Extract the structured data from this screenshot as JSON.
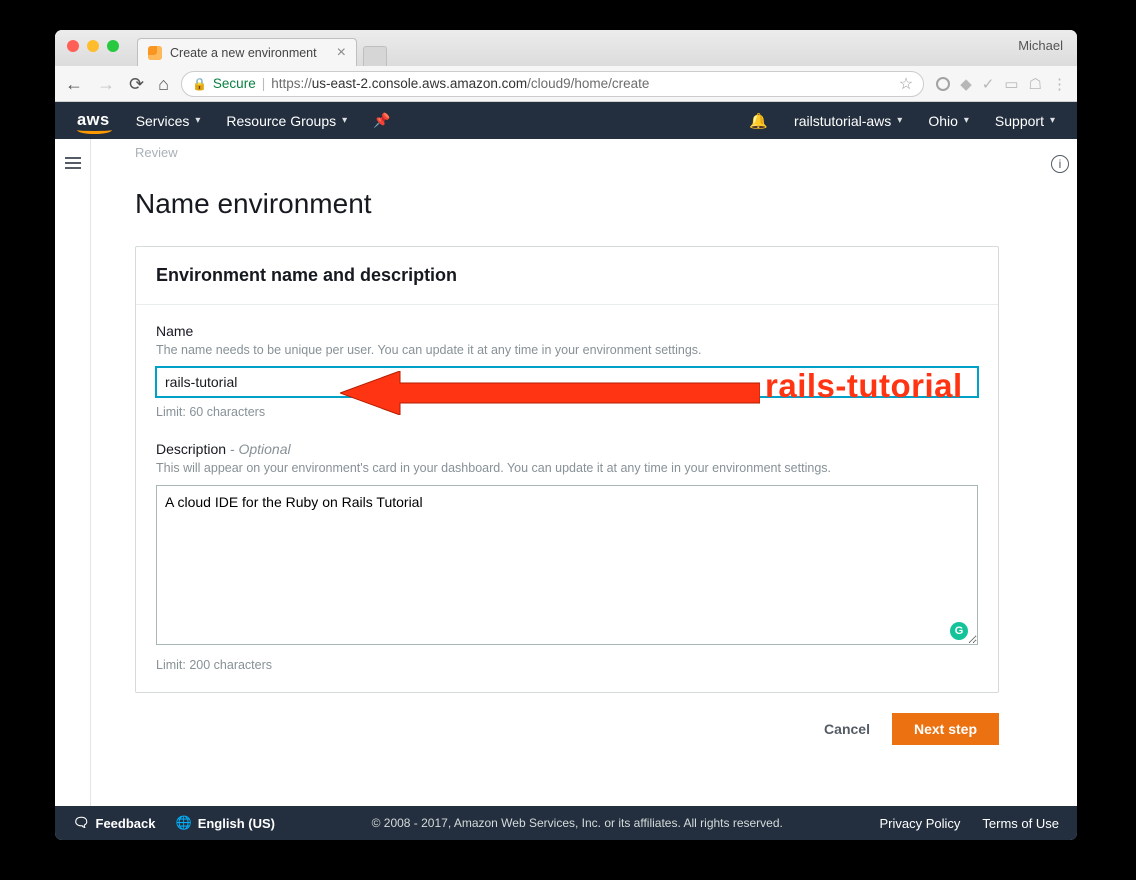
{
  "browser": {
    "profile": "Michael",
    "tab_title": "Create a new environment",
    "secure_label": "Secure",
    "url_prefix": "https://",
    "url_host": "us-east-2.console.aws.amazon.com",
    "url_path": "/cloud9/home/create"
  },
  "aws_nav": {
    "logo": "aws",
    "services": "Services",
    "resource_groups": "Resource Groups",
    "account": "railstutorial-aws",
    "region": "Ohio",
    "support": "Support"
  },
  "breadcrumb": "Review",
  "page_title": "Name environment",
  "panel": {
    "heading": "Environment name and description",
    "name_label": "Name",
    "name_help": "The name needs to be unique per user. You can update it at any time in your environment settings.",
    "name_value": "rails-tutorial",
    "name_limit": "Limit: 60 characters",
    "desc_label": "Description",
    "desc_optional": " - Optional",
    "desc_help": "This will appear on your environment's card in your dashboard. You can update it at any time in your environment settings.",
    "desc_value": "A cloud IDE for the Ruby on Rails Tutorial",
    "desc_limit": "Limit: 200 characters"
  },
  "buttons": {
    "cancel": "Cancel",
    "next": "Next step"
  },
  "footer": {
    "feedback": "Feedback",
    "language": "English (US)",
    "copyright": "© 2008 - 2017, Amazon Web Services, Inc. or its affiliates. All rights reserved.",
    "privacy": "Privacy Policy",
    "terms": "Terms of Use"
  },
  "annotation": {
    "text": "rails-tutorial"
  }
}
